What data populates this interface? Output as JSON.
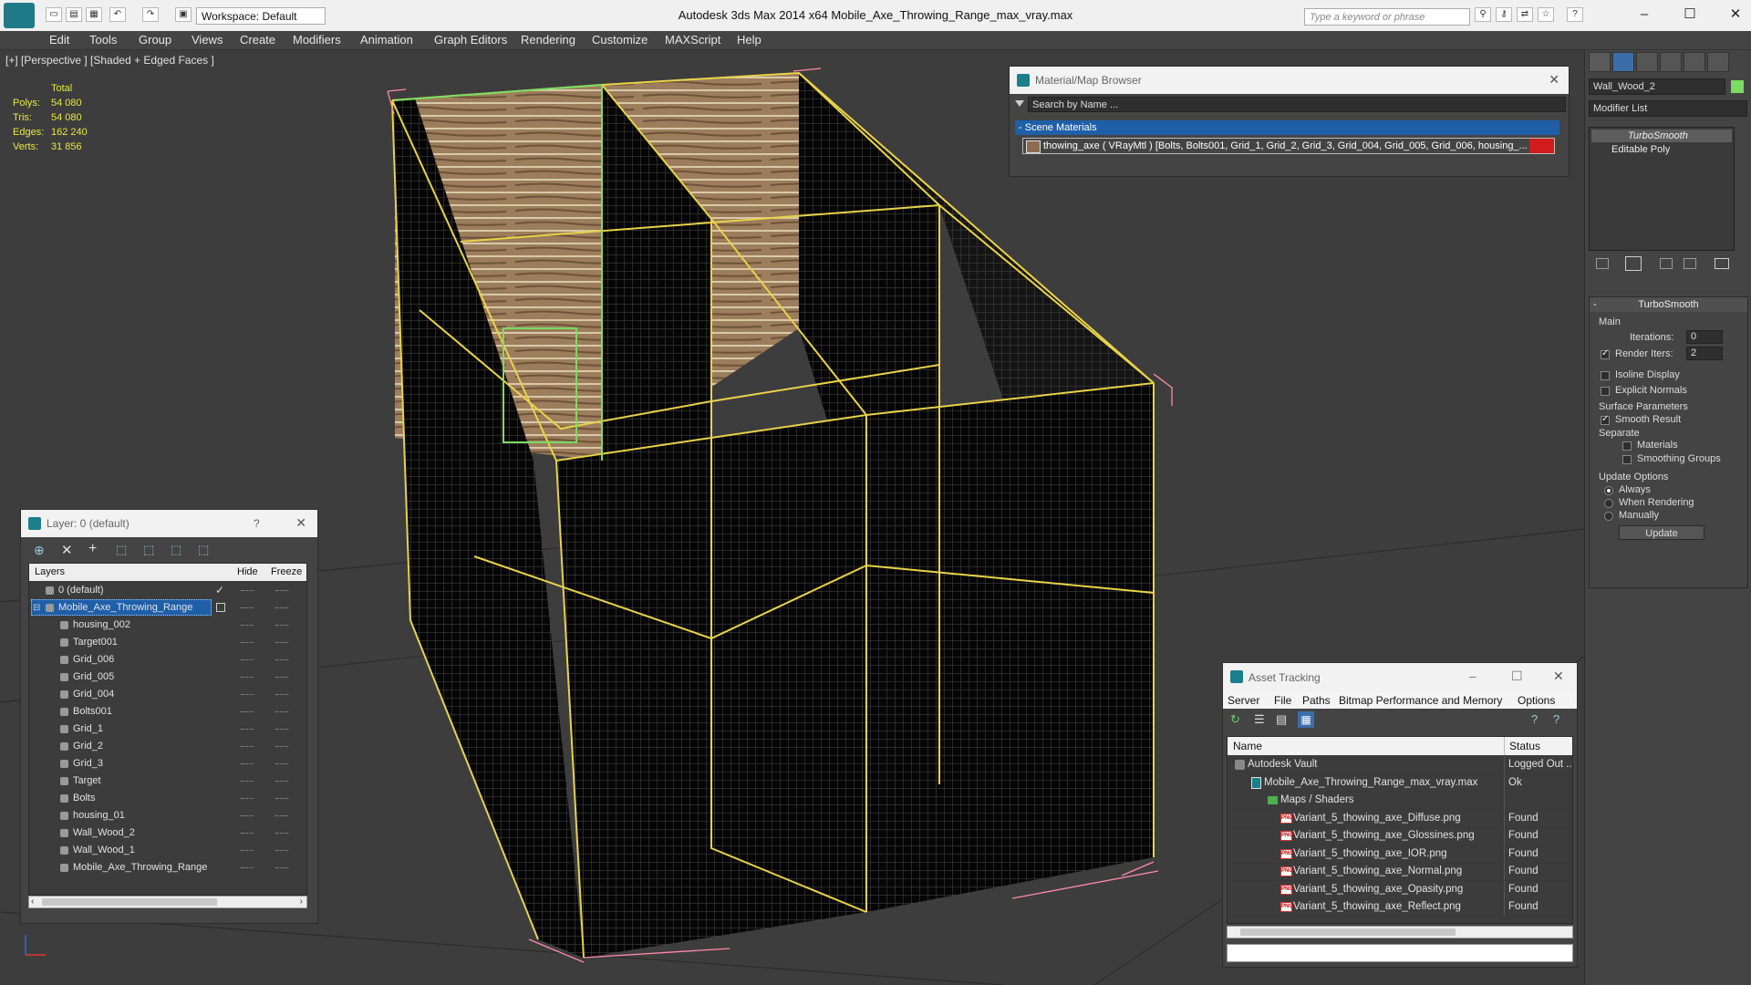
{
  "app": {
    "title": "Autodesk 3ds Max  2014 x64      Mobile_Axe_Throwing_Range_max_vray.max",
    "workspace": "Workspace: Default",
    "search_placeholder": "Type a keyword or phrase"
  },
  "menu": [
    "Edit",
    "Tools",
    "Group",
    "Views",
    "Create",
    "Modifiers",
    "Animation",
    "Graph Editors",
    "Rendering",
    "Customize",
    "MAXScript",
    "Help"
  ],
  "viewport": {
    "label": "[+] [Perspective ] [Shaded + Edged Faces ]",
    "stats": {
      "header": "Total",
      "rows": [
        {
          "label": "Polys:",
          "value": "54 080"
        },
        {
          "label": "Tris:",
          "value": "54 080"
        },
        {
          "label": "Edges:",
          "value": "162 240"
        },
        {
          "label": "Verts:",
          "value": "31 856"
        }
      ]
    }
  },
  "material_browser": {
    "title": "Material/Map Browser",
    "search_placeholder": "Search by Name ...",
    "section": "Scene Materials",
    "item": "thowing_axe  ( VRayMtl ) [Bolts, Bolts001, Grid_1, Grid_2, Grid_3, Grid_004, Grid_005, Grid_006, housing_..."
  },
  "command_panel": {
    "object_name": "Wall_Wood_2",
    "modifier_list": "Modifier List",
    "stack": [
      "TurboSmooth",
      "Editable Poly"
    ],
    "rollout_title": "TurboSmooth",
    "main_label": "Main",
    "iterations_label": "Iterations:",
    "iterations_value": "0",
    "render_iters_label": "Render Iters:",
    "render_iters_value": "2",
    "isoline_label": "Isoline Display",
    "explicit_label": "Explicit Normals",
    "surface_label": "Surface Parameters",
    "smooth_result_label": "Smooth Result",
    "separate_label": "Separate",
    "materials_label": "Materials",
    "smoothing_groups_label": "Smoothing Groups",
    "update_options_label": "Update Options",
    "always_label": "Always",
    "when_rendering_label": "When Rendering",
    "manually_label": "Manually",
    "update_button": "Update"
  },
  "layer_dialog": {
    "title": "Layer: 0 (default)",
    "help": "?",
    "columns": {
      "layers": "Layers",
      "hide": "Hide",
      "freeze": "Freeze"
    },
    "rows": [
      {
        "name": "0 (default)",
        "level": 0,
        "selected": false
      },
      {
        "name": "Mobile_Axe_Throwing_Range",
        "level": 0,
        "selected": true
      },
      {
        "name": "housing_002",
        "level": 1
      },
      {
        "name": "Target001",
        "level": 1
      },
      {
        "name": "Grid_006",
        "level": 1
      },
      {
        "name": "Grid_005",
        "level": 1
      },
      {
        "name": "Grid_004",
        "level": 1
      },
      {
        "name": "Bolts001",
        "level": 1
      },
      {
        "name": "Grid_1",
        "level": 1
      },
      {
        "name": "Grid_2",
        "level": 1
      },
      {
        "name": "Grid_3",
        "level": 1
      },
      {
        "name": "Target",
        "level": 1
      },
      {
        "name": "Bolts",
        "level": 1
      },
      {
        "name": "housing_01",
        "level": 1
      },
      {
        "name": "Wall_Wood_2",
        "level": 1
      },
      {
        "name": "Wall_Wood_1",
        "level": 1
      },
      {
        "name": "Mobile_Axe_Throwing_Range",
        "level": 1
      }
    ]
  },
  "asset_tracking": {
    "title": "Asset Tracking",
    "menu": [
      "Server",
      "File",
      "Paths",
      "Bitmap Performance and Memory",
      "Options"
    ],
    "columns": {
      "name": "Name",
      "status": "Status"
    },
    "rows": [
      {
        "name": "Autodesk Vault",
        "status": "Logged Out ..",
        "level": 0,
        "icon": "vault"
      },
      {
        "name": "Mobile_Axe_Throwing_Range_max_vray.max",
        "status": "Ok",
        "level": 1,
        "icon": "max"
      },
      {
        "name": "Maps / Shaders",
        "status": "",
        "level": 2,
        "icon": "folder"
      },
      {
        "name": "Variant_5_thowing_axe_Diffuse.png",
        "status": "Found",
        "level": 3,
        "icon": "png"
      },
      {
        "name": "Variant_5_thowing_axe_Glossines.png",
        "status": "Found",
        "level": 3,
        "icon": "png"
      },
      {
        "name": "Variant_5_thowing_axe_IOR.png",
        "status": "Found",
        "level": 3,
        "icon": "png"
      },
      {
        "name": "Variant_5_thowing_axe_Normal.png",
        "status": "Found",
        "level": 3,
        "icon": "png"
      },
      {
        "name": "Variant_5_thowing_axe_Opasity.png",
        "status": "Found",
        "level": 3,
        "icon": "png"
      },
      {
        "name": "Variant_5_thowing_axe_Reflect.png",
        "status": "Found",
        "level": 3,
        "icon": "png"
      }
    ]
  },
  "colors": {
    "wire": "#e8d24a",
    "selection": "#ff8aa8",
    "accent": "#1f5fa8",
    "highlight_green": "#7bdc62"
  }
}
